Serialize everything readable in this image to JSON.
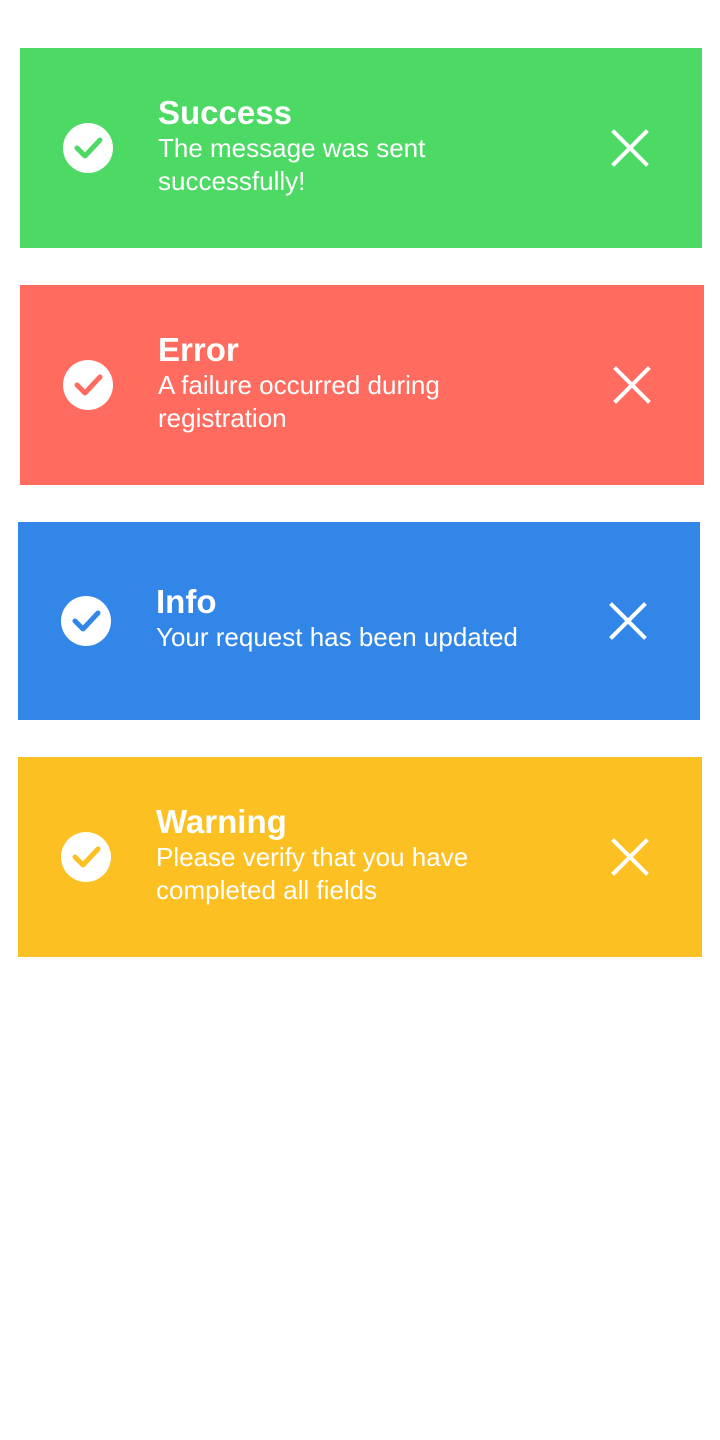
{
  "toasts": [
    {
      "type": "success",
      "title": "Success",
      "message": "The message was sent successfully!",
      "color": "#4cd964",
      "icon": "check-circle-icon",
      "close_icon": "close-icon"
    },
    {
      "type": "error",
      "title": "Error",
      "message": "A failure occurred during registration",
      "color": "#ff6b5f",
      "icon": "check-circle-icon",
      "close_icon": "close-icon"
    },
    {
      "type": "info",
      "title": "Info",
      "message": "Your request has been updated",
      "color": "#3186e8",
      "icon": "check-circle-icon",
      "close_icon": "close-icon"
    },
    {
      "type": "warning",
      "title": "Warning",
      "message": "Please verify that you have completed all fields",
      "color": "#fdc022",
      "icon": "check-circle-icon",
      "close_icon": "close-icon"
    }
  ]
}
